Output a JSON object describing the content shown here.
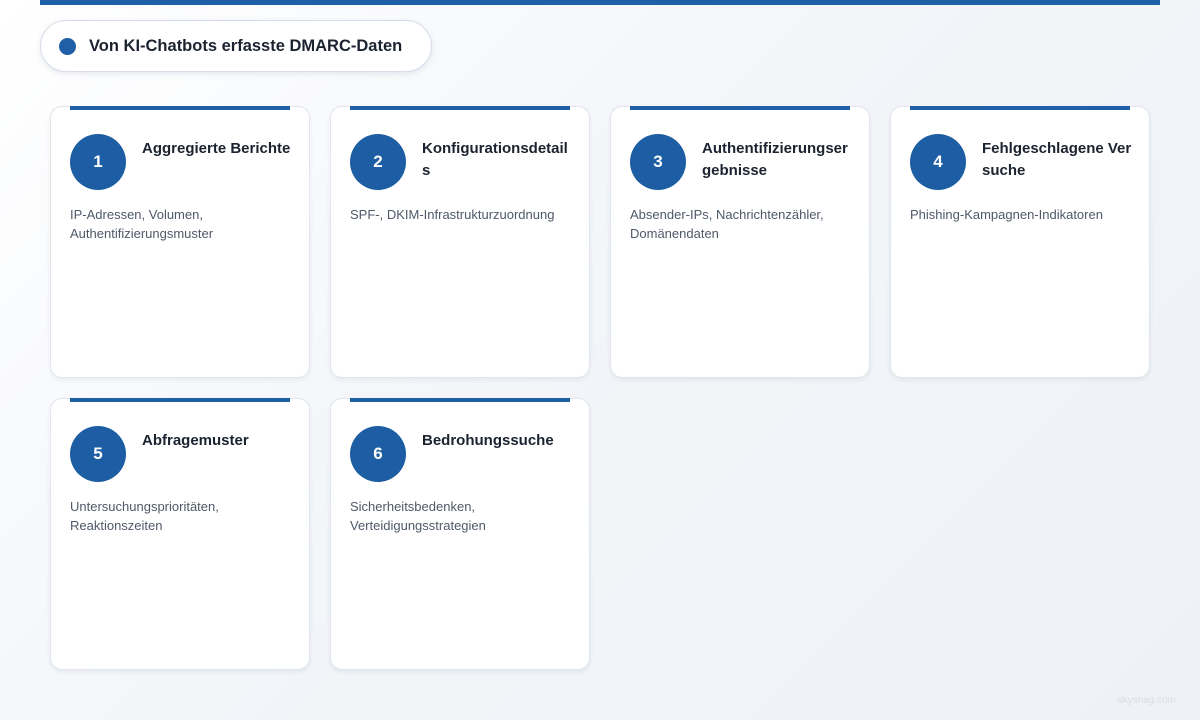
{
  "header": {
    "title": "Von KI-Chatbots erfasste DMARC-Daten"
  },
  "cards": [
    {
      "number": "1",
      "title": "Aggregierte Berichte",
      "description": "IP-Adressen, Volumen, Authentifizierungsmuster"
    },
    {
      "number": "2",
      "title": "Konfigurationsdetails",
      "description": "SPF-, DKIM-Infrastrukturzuordnung"
    },
    {
      "number": "3",
      "title": "Authentifizierungsergebnisse",
      "description": "Absender-IPs, Nachrichtenzähler, Domänendaten"
    },
    {
      "number": "4",
      "title": "Fehlgeschlagene Versuche",
      "description": "Phishing-Kampagnen-Indikatoren"
    },
    {
      "number": "5",
      "title": "Abfragemuster",
      "description": "Untersuchungsprioritäten, Reaktionszeiten"
    },
    {
      "number": "6",
      "title": "Bedrohungssuche",
      "description": "Sicherheitsbedenken, Verteidigungsstrategien"
    }
  ],
  "footer": {
    "watermark": "skysnag.com"
  },
  "colors": {
    "accent": "#1f5fa6"
  }
}
